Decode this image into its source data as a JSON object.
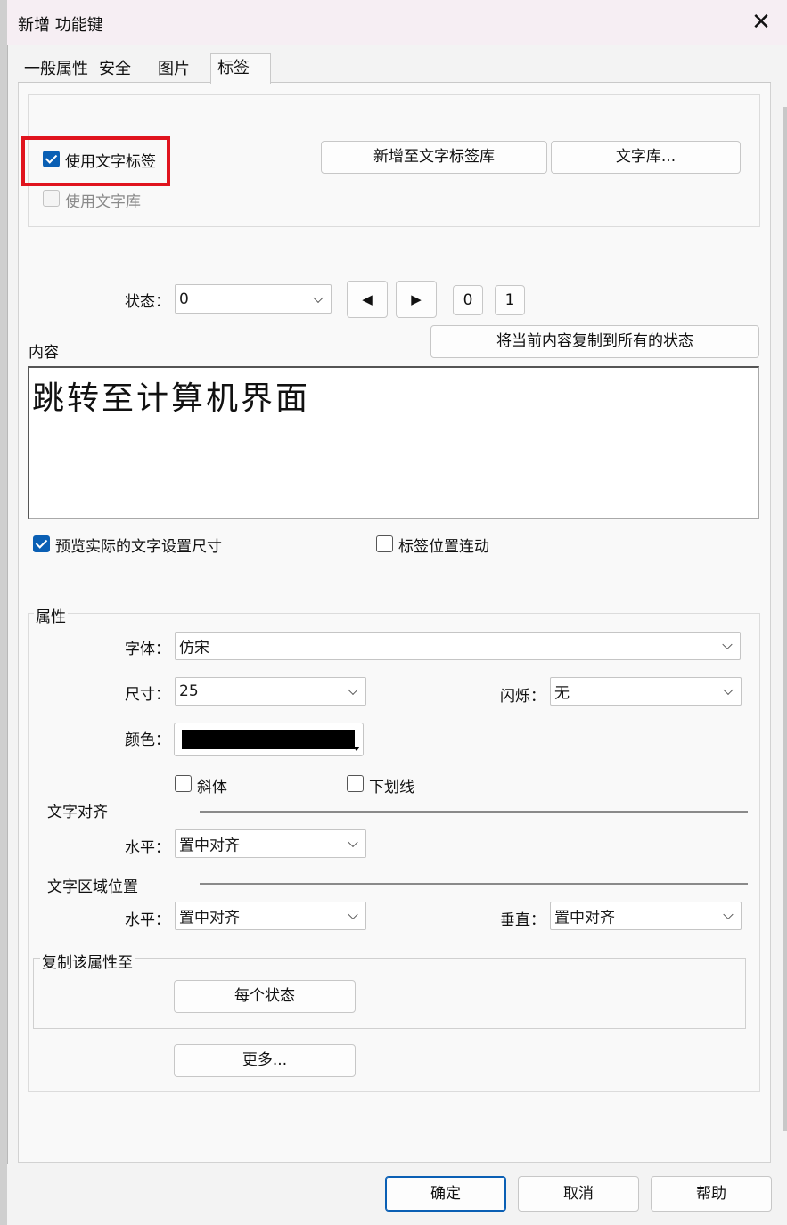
{
  "window": {
    "title": "新增 功能键",
    "close_glyph": "✕"
  },
  "tabs": [
    {
      "label": "一般属性"
    },
    {
      "label": "安全"
    },
    {
      "label": "图片"
    },
    {
      "label": "标签",
      "active": true
    }
  ],
  "label_options": {
    "use_text_label": {
      "label": "使用文字标签",
      "checked": true
    },
    "use_text_library": {
      "label": "使用文字库",
      "checked": false,
      "disabled": true
    },
    "add_to_library_button": "新增至文字标签库",
    "text_library_button": "文字库..."
  },
  "state": {
    "label": "状态：",
    "value": "0",
    "prev_glyph": "◀",
    "next_glyph": "▶",
    "box_0": "0",
    "box_1": "1",
    "copy_to_all_button": "将当前内容复制到所有的状态"
  },
  "content": {
    "label": "内容",
    "text": "跳转至计算机界面"
  },
  "preview_options": {
    "preview_actual": {
      "label": "预览实际的文字设置尺寸",
      "checked": true
    },
    "label_position_link": {
      "label": "标签位置连动",
      "checked": false
    }
  },
  "properties": {
    "group_label": "属性",
    "font_label": "字体：",
    "font_value": "仿宋",
    "size_label": "尺寸：",
    "size_value": "25",
    "blink_label": "闪烁：",
    "blink_value": "无",
    "color_label": "颜色：",
    "color_value": "#000000",
    "italic": {
      "label": "斜体",
      "checked": false
    },
    "underline": {
      "label": "下划线",
      "checked": false
    },
    "text_align_title": "文字对齐",
    "text_align_h_label": "水平：",
    "text_align_h_value": "置中对齐",
    "area_pos_title": "文字区域位置",
    "area_h_label": "水平：",
    "area_h_value": "置中对齐",
    "area_v_label": "垂直：",
    "area_v_value": "置中对齐",
    "copy_group_label": "复制该属性至",
    "each_state_button": "每个状态",
    "more_button": "更多..."
  },
  "footer": {
    "ok": "确定",
    "cancel": "取消",
    "help": "帮助"
  },
  "colors": {
    "accent": "#0a5fb4",
    "highlight": "#e0141e"
  }
}
